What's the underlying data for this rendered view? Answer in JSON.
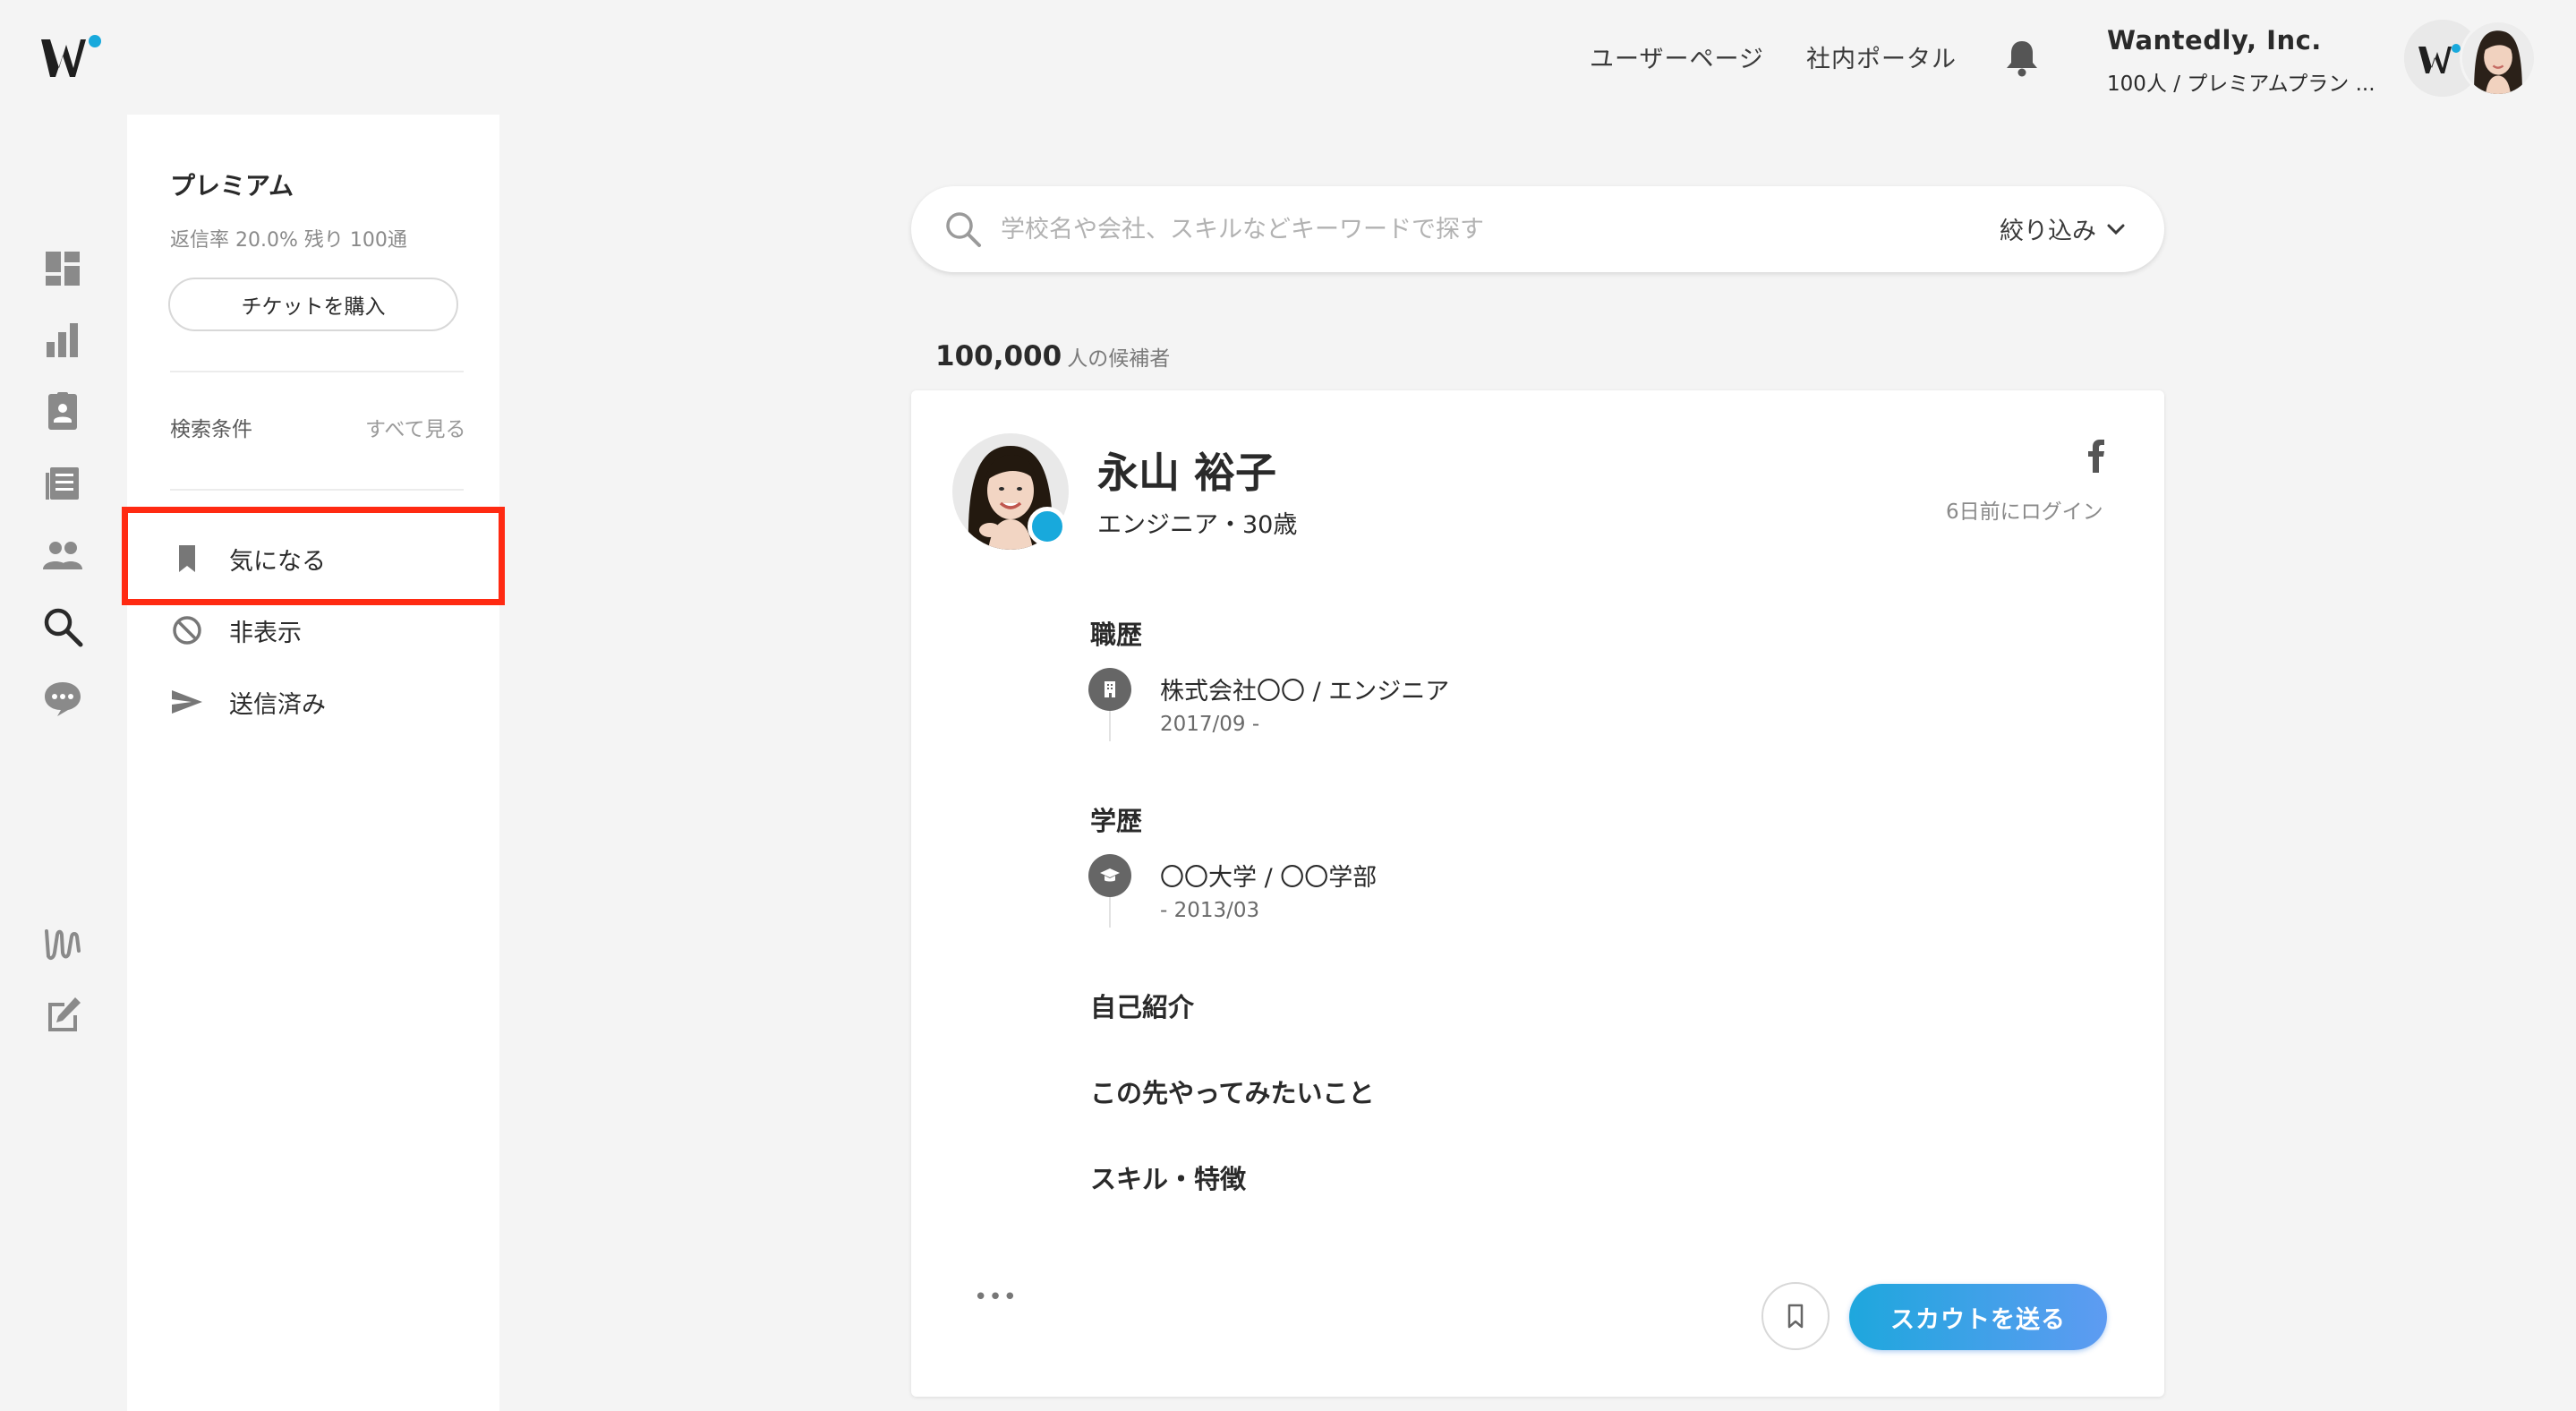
{
  "header": {
    "nav_user_page": "ユーザーページ",
    "nav_portal": "社内ポータル",
    "company_name": "Wantedly, Inc.",
    "company_plan": "100人 / プレミアムプラン ..."
  },
  "icons": {
    "logo": "wantedly-logo",
    "rail": [
      "dashboard-icon",
      "chart-icon",
      "profile-card-icon",
      "article-icon",
      "people-icon",
      "search-icon",
      "chat-icon",
      "wantedly-script-icon",
      "edit-icon"
    ],
    "bell": "bell-icon"
  },
  "sidebar": {
    "plan_title": "プレミアム",
    "plan_stats": "返信率 20.0%  残り 100通",
    "buy_ticket": "チケットを購入",
    "search_conditions": "検索条件",
    "see_all": "すべて見る",
    "items": [
      {
        "label": "気になる",
        "icon": "bookmark-icon"
      },
      {
        "label": "非表示",
        "icon": "hide-icon"
      },
      {
        "label": "送信済み",
        "icon": "send-icon"
      }
    ]
  },
  "search": {
    "placeholder": "学校名や会社、スキルなどキーワードで探す",
    "filter_label": "絞り込み"
  },
  "results": {
    "count": "100,000",
    "unit": "人の候補者"
  },
  "candidate": {
    "name": "永山 裕子",
    "role": "エンジニア・30歳",
    "last_login": "6日前にログイン",
    "career_title": "職歴",
    "career": {
      "title": "株式会社〇〇 / エンジニア",
      "date": "2017/09 -"
    },
    "education_title": "学歴",
    "education": {
      "title": "〇〇大学 / 〇〇学部",
      "date": "- 2013/03"
    },
    "intro_title": "自己紹介",
    "future_title": "この先やってみたいこと",
    "skills_title": "スキル・特徴",
    "more": "•••",
    "scout_button": "スカウトを送る"
  },
  "colors": {
    "accent": "#18a9dc",
    "highlight": "#ff2a12",
    "scout_gradient_start": "#1ea7dd",
    "scout_gradient_end": "#5e9bf2"
  }
}
